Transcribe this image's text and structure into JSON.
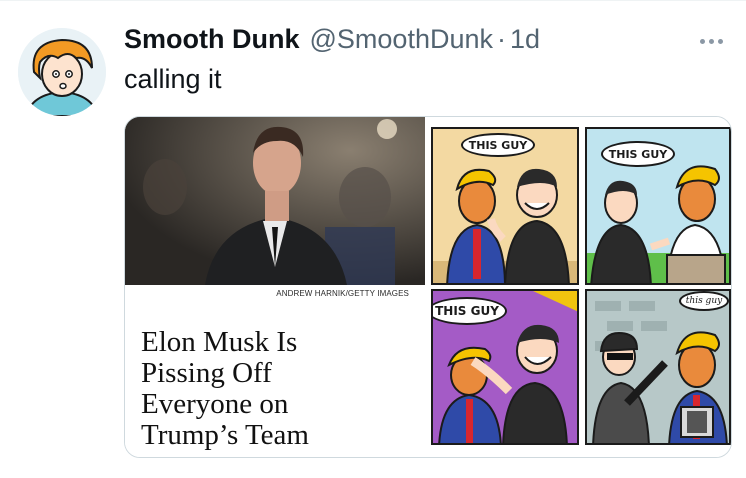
{
  "tweet": {
    "display_name": "Smooth Dunk",
    "handle": "@SmoothDunk",
    "separator": "·",
    "time": "1d",
    "text": "calling it",
    "avatar_icon": "cartoon-avatar-icon",
    "more_icon": "more-icon"
  },
  "media": {
    "photo_credit": "ANDREW HARNIK/GETTY IMAGES",
    "headline_lines": [
      "Elon Musk Is",
      "Pissing Off",
      "Everyone on",
      "Trump’s Team"
    ],
    "comic": {
      "panel1_bubble": "THIS GUY",
      "panel2_bubble": "THIS GUY",
      "panel3_bubble": "THIS GUY",
      "panel4_bubble": "this guy"
    }
  },
  "colors": {
    "text_primary": "#0f1419",
    "text_secondary": "#536471",
    "border": "#cfd9de"
  }
}
